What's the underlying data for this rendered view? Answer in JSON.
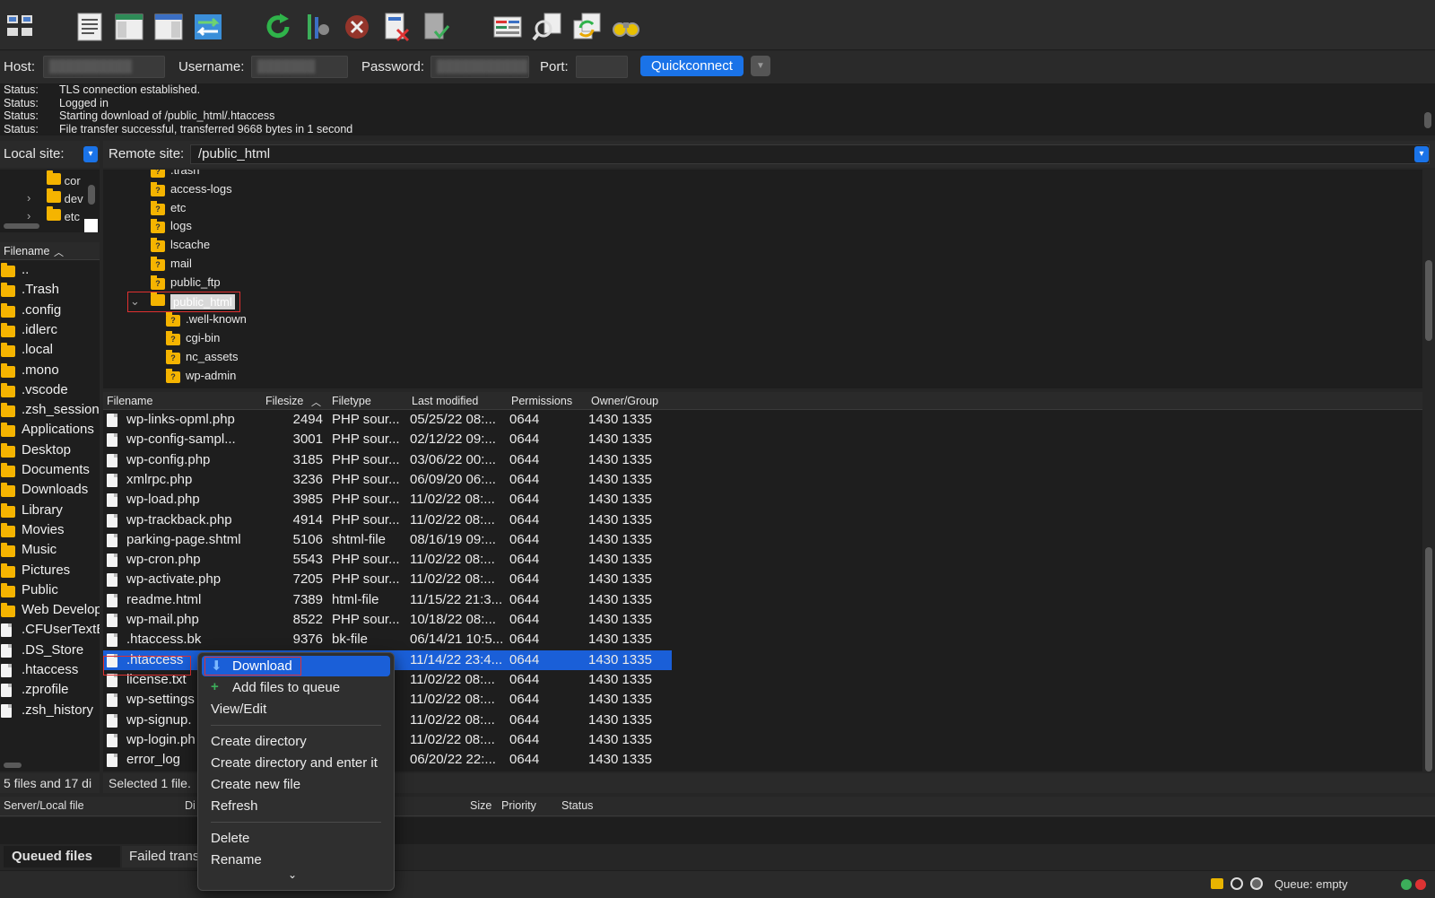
{
  "toolbar": {
    "icons": [
      "site-manager-icon",
      "toggle-log-icon",
      "toggle-local-tree-icon",
      "toggle-remote-tree-icon",
      "transfer-queue-icon",
      "refresh-icon",
      "process-queue-icon",
      "cancel-icon",
      "disconnect-icon",
      "reconnect-icon",
      "directory-filter-icon",
      "compare-icon",
      "sync-browse-icon",
      "search-icon"
    ]
  },
  "quickconnect": {
    "host_label": "Host:",
    "username_label": "Username:",
    "password_label": "Password:",
    "port_label": "Port:",
    "button_label": "Quickconnect"
  },
  "log": [
    {
      "key": "Status:",
      "msg": "TLS connection established."
    },
    {
      "key": "Status:",
      "msg": "Logged in"
    },
    {
      "key": "Status:",
      "msg": "Starting download of /public_html/.htaccess"
    },
    {
      "key": "Status:",
      "msg": "File transfer successful, transferred 9668 bytes in 1 second"
    }
  ],
  "local_site": {
    "label": "Local site:"
  },
  "remote_site": {
    "label": "Remote site:",
    "path": "/public_html"
  },
  "local_tree": [
    "cor",
    "dev",
    "etc"
  ],
  "local_list": {
    "header": "Filename",
    "items": [
      {
        "name": "..",
        "type": "folder"
      },
      {
        "name": ".Trash",
        "type": "folder"
      },
      {
        "name": ".config",
        "type": "folder"
      },
      {
        "name": ".idlerc",
        "type": "folder"
      },
      {
        "name": ".local",
        "type": "folder"
      },
      {
        "name": ".mono",
        "type": "folder"
      },
      {
        "name": ".vscode",
        "type": "folder"
      },
      {
        "name": ".zsh_sessions",
        "type": "folder"
      },
      {
        "name": "Applications",
        "type": "folder"
      },
      {
        "name": "Desktop",
        "type": "folder"
      },
      {
        "name": "Documents",
        "type": "folder"
      },
      {
        "name": "Downloads",
        "type": "folder"
      },
      {
        "name": "Library",
        "type": "folder"
      },
      {
        "name": "Movies",
        "type": "folder"
      },
      {
        "name": "Music",
        "type": "folder"
      },
      {
        "name": "Pictures",
        "type": "folder"
      },
      {
        "name": "Public",
        "type": "folder"
      },
      {
        "name": "Web Develop",
        "type": "folder"
      },
      {
        "name": ".CFUserTextE",
        "type": "file"
      },
      {
        "name": ".DS_Store",
        "type": "file"
      },
      {
        "name": ".htaccess",
        "type": "file"
      },
      {
        "name": ".zprofile",
        "type": "file"
      },
      {
        "name": ".zsh_history",
        "type": "file"
      }
    ],
    "status": "5 files and 17 di"
  },
  "remote_tree": [
    {
      "name": ".trash",
      "level": 1
    },
    {
      "name": "access-logs",
      "level": 1
    },
    {
      "name": "etc",
      "level": 1
    },
    {
      "name": "logs",
      "level": 1
    },
    {
      "name": "lscache",
      "level": 1
    },
    {
      "name": "mail",
      "level": 1
    },
    {
      "name": "public_ftp",
      "level": 1
    },
    {
      "name": "public_html",
      "level": 1,
      "expanded": true,
      "selected": true
    },
    {
      "name": ".well-known",
      "level": 2
    },
    {
      "name": "cgi-bin",
      "level": 2
    },
    {
      "name": "nc_assets",
      "level": 2
    },
    {
      "name": "wp-admin",
      "level": 2
    }
  ],
  "remote_list": {
    "headers": {
      "filename": "Filename",
      "filesize": "Filesize",
      "filetype": "Filetype",
      "modified": "Last modified",
      "perms": "Permissions",
      "owner": "Owner/Group"
    },
    "rows": [
      {
        "name": "wp-links-opml.php",
        "size": "2494",
        "type": "PHP sour...",
        "modified": "05/25/22 08:...",
        "perms": "0644",
        "owner": "1430 1335"
      },
      {
        "name": "wp-config-sampl...",
        "size": "3001",
        "type": "PHP sour...",
        "modified": "02/12/22 09:...",
        "perms": "0644",
        "owner": "1430 1335"
      },
      {
        "name": "wp-config.php",
        "size": "3185",
        "type": "PHP sour...",
        "modified": "03/06/22 00:...",
        "perms": "0644",
        "owner": "1430 1335"
      },
      {
        "name": "xmlrpc.php",
        "size": "3236",
        "type": "PHP sour...",
        "modified": "06/09/20 06:...",
        "perms": "0644",
        "owner": "1430 1335"
      },
      {
        "name": "wp-load.php",
        "size": "3985",
        "type": "PHP sour...",
        "modified": "11/02/22 08:...",
        "perms": "0644",
        "owner": "1430 1335"
      },
      {
        "name": "wp-trackback.php",
        "size": "4914",
        "type": "PHP sour...",
        "modified": "11/02/22 08:...",
        "perms": "0644",
        "owner": "1430 1335"
      },
      {
        "name": "parking-page.shtml",
        "size": "5106",
        "type": "shtml-file",
        "modified": "08/16/19 09:...",
        "perms": "0644",
        "owner": "1430 1335"
      },
      {
        "name": "wp-cron.php",
        "size": "5543",
        "type": "PHP sour...",
        "modified": "11/02/22 08:...",
        "perms": "0644",
        "owner": "1430 1335"
      },
      {
        "name": "wp-activate.php",
        "size": "7205",
        "type": "PHP sour...",
        "modified": "11/02/22 08:...",
        "perms": "0644",
        "owner": "1430 1335"
      },
      {
        "name": "readme.html",
        "size": "7389",
        "type": "html-file",
        "modified": "11/15/22 21:3...",
        "perms": "0644",
        "owner": "1430 1335"
      },
      {
        "name": "wp-mail.php",
        "size": "8522",
        "type": "PHP sour...",
        "modified": "10/18/22 08:...",
        "perms": "0644",
        "owner": "1430 1335"
      },
      {
        "name": ".htaccess.bk",
        "size": "9376",
        "type": "bk-file",
        "modified": "06/14/21 10:5...",
        "perms": "0644",
        "owner": "1430 1335"
      },
      {
        "name": ".htaccess",
        "size": "",
        "type": "",
        "modified": "11/14/22 23:4...",
        "perms": "0644",
        "owner": "1430 1335",
        "selected": true
      },
      {
        "name": "license.txt",
        "size": "",
        "type": "",
        "modified": "11/02/22 08:...",
        "perms": "0644",
        "owner": "1430 1335"
      },
      {
        "name": "wp-settings",
        "size": "",
        "type": "",
        "modified": "11/02/22 08:...",
        "perms": "0644",
        "owner": "1430 1335"
      },
      {
        "name": "wp-signup.",
        "size": "",
        "type": "",
        "modified": "11/02/22 08:...",
        "perms": "0644",
        "owner": "1430 1335"
      },
      {
        "name": "wp-login.ph",
        "size": "",
        "type": "",
        "modified": "11/02/22 08:...",
        "perms": "0644",
        "owner": "1430 1335"
      },
      {
        "name": "error_log",
        "size": "",
        "type": "",
        "modified": "06/20/22 22:...",
        "perms": "0644",
        "owner": "1430 1335"
      }
    ],
    "status": "Selected 1 file."
  },
  "context_menu": {
    "download": "Download",
    "add_to_queue": "Add files to queue",
    "view_edit": "View/Edit",
    "create_dir": "Create directory",
    "create_dir_enter": "Create directory and enter it",
    "create_file": "Create new file",
    "refresh": "Refresh",
    "delete": "Delete",
    "rename": "Rename"
  },
  "queue": {
    "headers": {
      "server_local": "Server/Local file",
      "direction": "Di",
      "size": "Size",
      "priority": "Priority",
      "status": "Status"
    },
    "tabs": {
      "queued": "Queued files",
      "failed": "Failed trans"
    }
  },
  "statusbar": {
    "queue": "Queue: empty"
  },
  "colors": {
    "accent": "#1a73e8",
    "selection": "#1a5fd8",
    "folder": "#f5b400",
    "highlight_box": "#e03030"
  }
}
